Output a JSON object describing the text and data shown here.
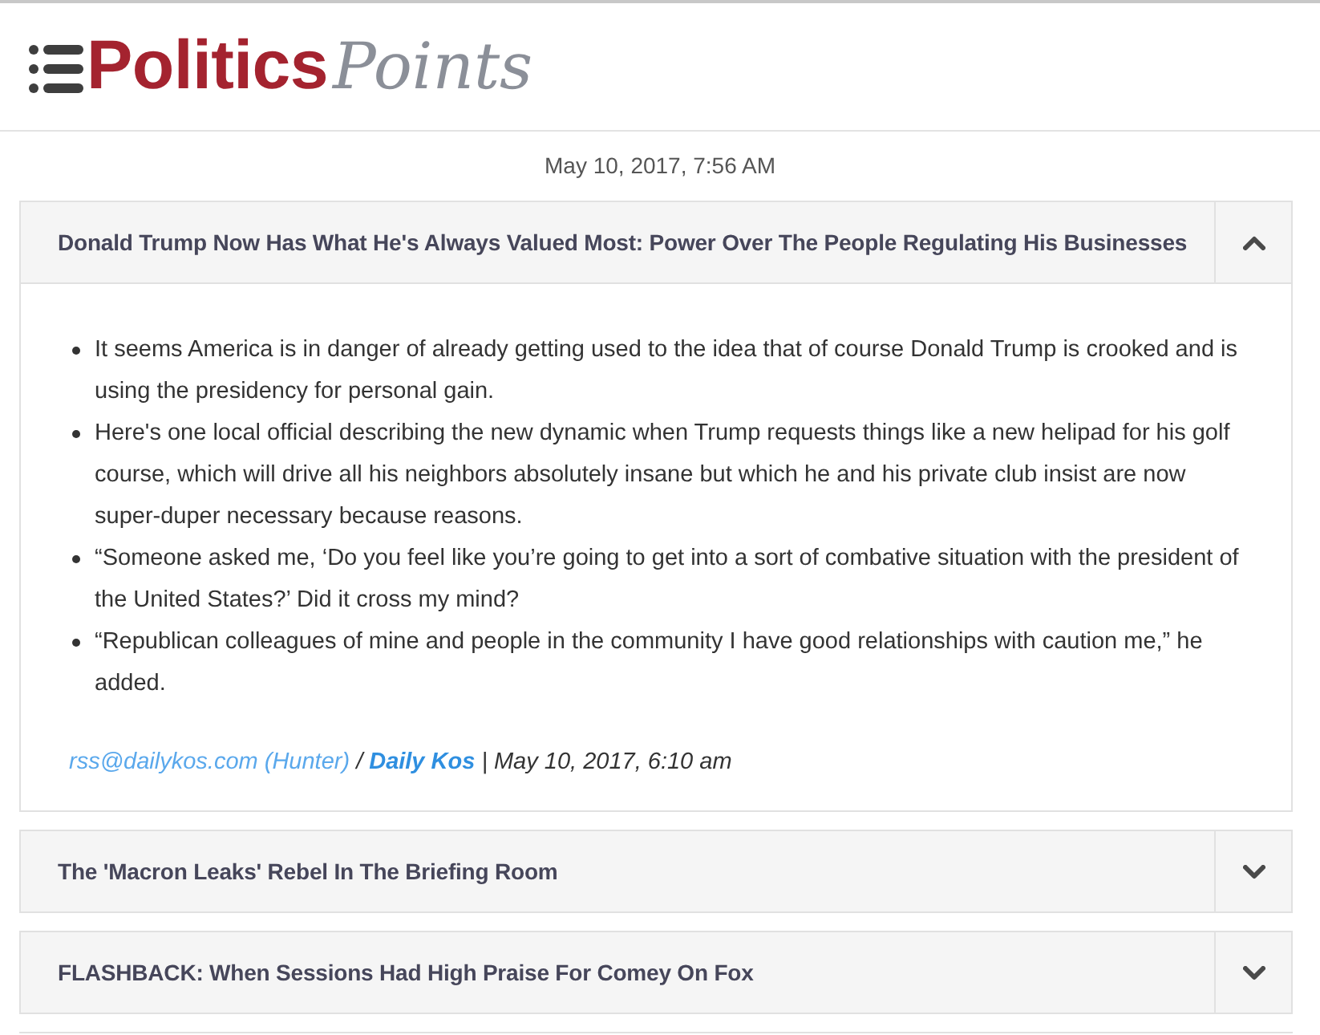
{
  "header": {
    "logo": {
      "primary": "Politics",
      "secondary": "Points"
    }
  },
  "timestamp": "May 10, 2017, 7:56 AM",
  "articles": [
    {
      "title": "Donald Trump Now Has What He's Always Valued Most: Power Over The People Regulating His Businesses",
      "expanded": true,
      "bullets": [
        "It seems America is in danger of already getting used to the idea that of course Donald Trump is crooked and is using the presidency for personal gain.",
        "Here's one local official describing the new dynamic when Trump requests things like a new helipad for his golf course, which will drive all his neighbors absolutely insane but which he and his private club insist are now super-duper necessary because reasons.",
        "“Someone asked me, ‘Do you feel like you’re going to get into a sort of combative situation with the president of the United States?’ Did it cross my mind?",
        "“Republican colleagues of mine and people in the community I have good relationships with caution me,” he added."
      ],
      "source": {
        "author": "rss@dailykos.com (Hunter)",
        "separator": "/",
        "outlet": "Daily Kos",
        "divider": "|",
        "date": "May 10, 2017, 6:10 am"
      }
    },
    {
      "title": "The 'Macron Leaks' Rebel In The Briefing Room",
      "expanded": false
    },
    {
      "title": "FLASHBACK: When Sessions Had High Praise For Comey On Fox",
      "expanded": false
    }
  ]
}
